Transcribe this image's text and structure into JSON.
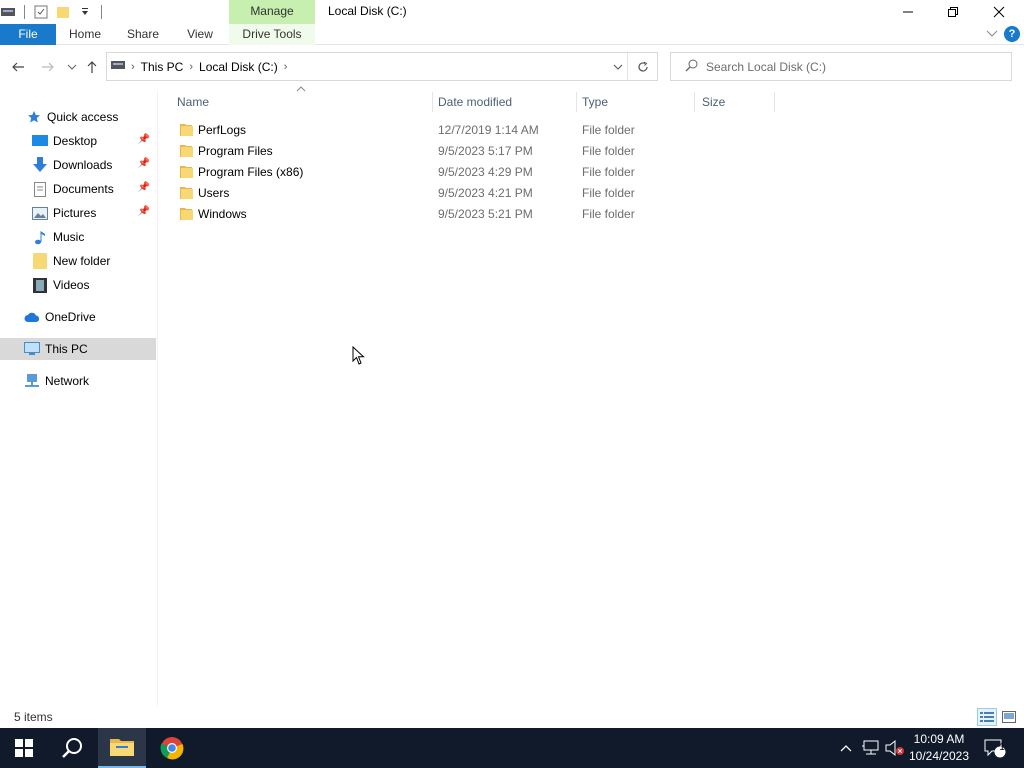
{
  "window": {
    "title": "Local Disk (C:)",
    "context_tab": "Manage"
  },
  "ribbon": {
    "tabs": [
      "File",
      "Home",
      "Share",
      "View",
      "Drive Tools"
    ]
  },
  "address": {
    "crumbs": [
      "This PC",
      "Local Disk (C:)"
    ],
    "search_placeholder": "Search Local Disk (C:)"
  },
  "nav": {
    "quick_access": "Quick access",
    "items": [
      "Desktop",
      "Downloads",
      "Documents",
      "Pictures",
      "Music",
      "New folder",
      "Videos"
    ],
    "onedrive": "OneDrive",
    "this_pc": "This PC",
    "network": "Network"
  },
  "columns": [
    "Name",
    "Date modified",
    "Type",
    "Size"
  ],
  "files": [
    {
      "name": "PerfLogs",
      "date": "12/7/2019 1:14 AM",
      "type": "File folder"
    },
    {
      "name": "Program Files",
      "date": "9/5/2023 5:17 PM",
      "type": "File folder"
    },
    {
      "name": "Program Files (x86)",
      "date": "9/5/2023 4:29 PM",
      "type": "File folder"
    },
    {
      "name": "Users",
      "date": "9/5/2023 4:21 PM",
      "type": "File folder"
    },
    {
      "name": "Windows",
      "date": "9/5/2023 5:21 PM",
      "type": "File folder"
    }
  ],
  "status": {
    "count": "5 items"
  },
  "taskbar": {
    "time": "10:09 AM",
    "date": "10/24/2023",
    "notification_count": "1"
  },
  "colors": {
    "file_tab": "#1979ca",
    "manage_tab": "#c6efb0",
    "folder": "#f8d775",
    "taskbar": "#101a2b"
  }
}
